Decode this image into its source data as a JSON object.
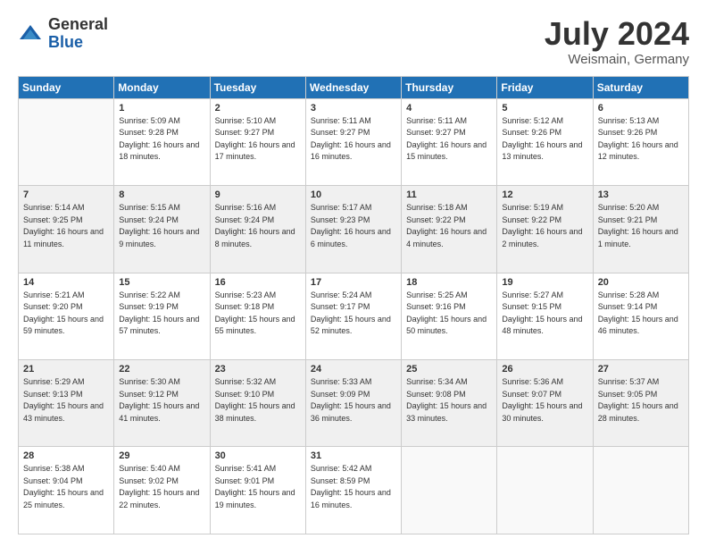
{
  "logo": {
    "general": "General",
    "blue": "Blue"
  },
  "header": {
    "month": "July 2024",
    "location": "Weismain, Germany"
  },
  "weekdays": [
    "Sunday",
    "Monday",
    "Tuesday",
    "Wednesday",
    "Thursday",
    "Friday",
    "Saturday"
  ],
  "weeks": [
    [
      {
        "day": "",
        "sunrise": "",
        "sunset": "",
        "daylight": ""
      },
      {
        "day": "1",
        "sunrise": "Sunrise: 5:09 AM",
        "sunset": "Sunset: 9:28 PM",
        "daylight": "Daylight: 16 hours and 18 minutes."
      },
      {
        "day": "2",
        "sunrise": "Sunrise: 5:10 AM",
        "sunset": "Sunset: 9:27 PM",
        "daylight": "Daylight: 16 hours and 17 minutes."
      },
      {
        "day": "3",
        "sunrise": "Sunrise: 5:11 AM",
        "sunset": "Sunset: 9:27 PM",
        "daylight": "Daylight: 16 hours and 16 minutes."
      },
      {
        "day": "4",
        "sunrise": "Sunrise: 5:11 AM",
        "sunset": "Sunset: 9:27 PM",
        "daylight": "Daylight: 16 hours and 15 minutes."
      },
      {
        "day": "5",
        "sunrise": "Sunrise: 5:12 AM",
        "sunset": "Sunset: 9:26 PM",
        "daylight": "Daylight: 16 hours and 13 minutes."
      },
      {
        "day": "6",
        "sunrise": "Sunrise: 5:13 AM",
        "sunset": "Sunset: 9:26 PM",
        "daylight": "Daylight: 16 hours and 12 minutes."
      }
    ],
    [
      {
        "day": "7",
        "sunrise": "Sunrise: 5:14 AM",
        "sunset": "Sunset: 9:25 PM",
        "daylight": "Daylight: 16 hours and 11 minutes."
      },
      {
        "day": "8",
        "sunrise": "Sunrise: 5:15 AM",
        "sunset": "Sunset: 9:24 PM",
        "daylight": "Daylight: 16 hours and 9 minutes."
      },
      {
        "day": "9",
        "sunrise": "Sunrise: 5:16 AM",
        "sunset": "Sunset: 9:24 PM",
        "daylight": "Daylight: 16 hours and 8 minutes."
      },
      {
        "day": "10",
        "sunrise": "Sunrise: 5:17 AM",
        "sunset": "Sunset: 9:23 PM",
        "daylight": "Daylight: 16 hours and 6 minutes."
      },
      {
        "day": "11",
        "sunrise": "Sunrise: 5:18 AM",
        "sunset": "Sunset: 9:22 PM",
        "daylight": "Daylight: 16 hours and 4 minutes."
      },
      {
        "day": "12",
        "sunrise": "Sunrise: 5:19 AM",
        "sunset": "Sunset: 9:22 PM",
        "daylight": "Daylight: 16 hours and 2 minutes."
      },
      {
        "day": "13",
        "sunrise": "Sunrise: 5:20 AM",
        "sunset": "Sunset: 9:21 PM",
        "daylight": "Daylight: 16 hours and 1 minute."
      }
    ],
    [
      {
        "day": "14",
        "sunrise": "Sunrise: 5:21 AM",
        "sunset": "Sunset: 9:20 PM",
        "daylight": "Daylight: 15 hours and 59 minutes."
      },
      {
        "day": "15",
        "sunrise": "Sunrise: 5:22 AM",
        "sunset": "Sunset: 9:19 PM",
        "daylight": "Daylight: 15 hours and 57 minutes."
      },
      {
        "day": "16",
        "sunrise": "Sunrise: 5:23 AM",
        "sunset": "Sunset: 9:18 PM",
        "daylight": "Daylight: 15 hours and 55 minutes."
      },
      {
        "day": "17",
        "sunrise": "Sunrise: 5:24 AM",
        "sunset": "Sunset: 9:17 PM",
        "daylight": "Daylight: 15 hours and 52 minutes."
      },
      {
        "day": "18",
        "sunrise": "Sunrise: 5:25 AM",
        "sunset": "Sunset: 9:16 PM",
        "daylight": "Daylight: 15 hours and 50 minutes."
      },
      {
        "day": "19",
        "sunrise": "Sunrise: 5:27 AM",
        "sunset": "Sunset: 9:15 PM",
        "daylight": "Daylight: 15 hours and 48 minutes."
      },
      {
        "day": "20",
        "sunrise": "Sunrise: 5:28 AM",
        "sunset": "Sunset: 9:14 PM",
        "daylight": "Daylight: 15 hours and 46 minutes."
      }
    ],
    [
      {
        "day": "21",
        "sunrise": "Sunrise: 5:29 AM",
        "sunset": "Sunset: 9:13 PM",
        "daylight": "Daylight: 15 hours and 43 minutes."
      },
      {
        "day": "22",
        "sunrise": "Sunrise: 5:30 AM",
        "sunset": "Sunset: 9:12 PM",
        "daylight": "Daylight: 15 hours and 41 minutes."
      },
      {
        "day": "23",
        "sunrise": "Sunrise: 5:32 AM",
        "sunset": "Sunset: 9:10 PM",
        "daylight": "Daylight: 15 hours and 38 minutes."
      },
      {
        "day": "24",
        "sunrise": "Sunrise: 5:33 AM",
        "sunset": "Sunset: 9:09 PM",
        "daylight": "Daylight: 15 hours and 36 minutes."
      },
      {
        "day": "25",
        "sunrise": "Sunrise: 5:34 AM",
        "sunset": "Sunset: 9:08 PM",
        "daylight": "Daylight: 15 hours and 33 minutes."
      },
      {
        "day": "26",
        "sunrise": "Sunrise: 5:36 AM",
        "sunset": "Sunset: 9:07 PM",
        "daylight": "Daylight: 15 hours and 30 minutes."
      },
      {
        "day": "27",
        "sunrise": "Sunrise: 5:37 AM",
        "sunset": "Sunset: 9:05 PM",
        "daylight": "Daylight: 15 hours and 28 minutes."
      }
    ],
    [
      {
        "day": "28",
        "sunrise": "Sunrise: 5:38 AM",
        "sunset": "Sunset: 9:04 PM",
        "daylight": "Daylight: 15 hours and 25 minutes."
      },
      {
        "day": "29",
        "sunrise": "Sunrise: 5:40 AM",
        "sunset": "Sunset: 9:02 PM",
        "daylight": "Daylight: 15 hours and 22 minutes."
      },
      {
        "day": "30",
        "sunrise": "Sunrise: 5:41 AM",
        "sunset": "Sunset: 9:01 PM",
        "daylight": "Daylight: 15 hours and 19 minutes."
      },
      {
        "day": "31",
        "sunrise": "Sunrise: 5:42 AM",
        "sunset": "Sunset: 8:59 PM",
        "daylight": "Daylight: 15 hours and 16 minutes."
      },
      {
        "day": "",
        "sunrise": "",
        "sunset": "",
        "daylight": ""
      },
      {
        "day": "",
        "sunrise": "",
        "sunset": "",
        "daylight": ""
      },
      {
        "day": "",
        "sunrise": "",
        "sunset": "",
        "daylight": ""
      }
    ]
  ]
}
